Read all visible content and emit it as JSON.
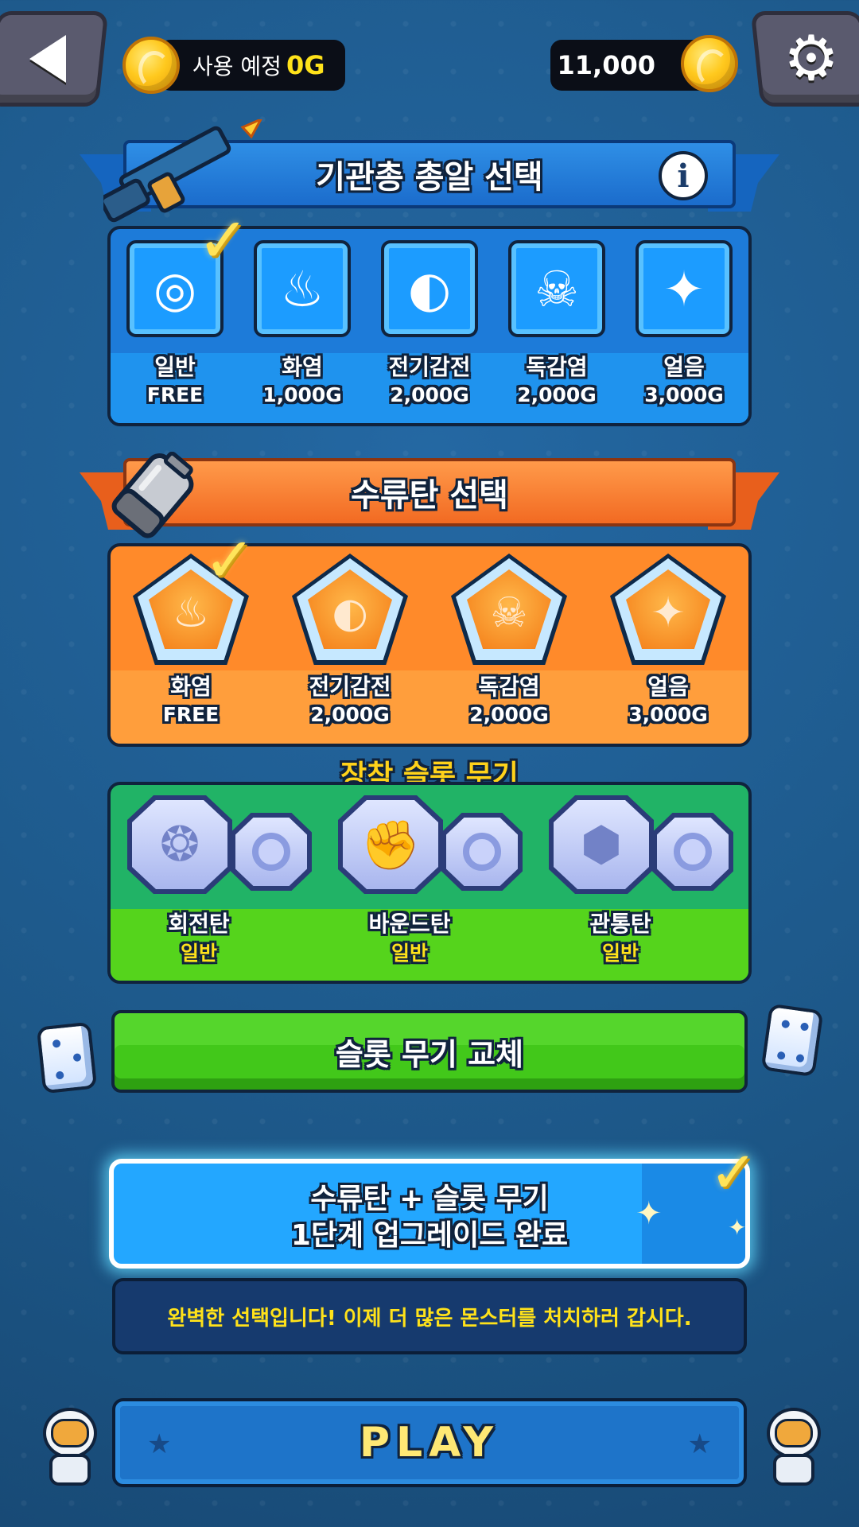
{
  "header": {
    "back_icon": "back-arrow-icon",
    "settings_icon": "gear-icon",
    "planned_label": "사용 예정",
    "planned_value": "0G",
    "balance": "11,000"
  },
  "machine_gun": {
    "title": "기관총 총알 선택",
    "info_label": "i",
    "items": [
      {
        "name": "일반",
        "price": "FREE",
        "icon": "ring-icon",
        "glyph": "◎"
      },
      {
        "name": "화염",
        "price": "1,000G",
        "icon": "flame-icon",
        "glyph": "♨"
      },
      {
        "name": "전기감전",
        "price": "2,000G",
        "icon": "electric-swirl-icon",
        "glyph": "◐"
      },
      {
        "name": "독감염",
        "price": "2,000G",
        "icon": "poison-skull-icon",
        "glyph": "☠"
      },
      {
        "name": "얼음",
        "price": "3,000G",
        "icon": "ice-star-icon",
        "glyph": "✦"
      }
    ],
    "selected_index": 0
  },
  "grenade": {
    "title": "수류탄 선택",
    "items": [
      {
        "name": "화염",
        "price": "FREE",
        "icon": "flame-icon",
        "glyph": "♨"
      },
      {
        "name": "전기감전",
        "price": "2,000G",
        "icon": "electric-swirl-icon",
        "glyph": "◐"
      },
      {
        "name": "독감염",
        "price": "2,000G",
        "icon": "poison-skull-icon",
        "glyph": "☠"
      },
      {
        "name": "얼음",
        "price": "3,000G",
        "icon": "ice-star-icon",
        "glyph": "✦"
      }
    ],
    "selected_index": 0
  },
  "slot_weapons": {
    "title": "장착 슬롯 무기",
    "items": [
      {
        "name": "회전탄",
        "grade": "일반",
        "icon": "spinning-ball-icon",
        "glyph": "❂"
      },
      {
        "name": "바운드탄",
        "grade": "일반",
        "icon": "boxing-glove-icon",
        "glyph": "✊"
      },
      {
        "name": "관통탄",
        "grade": "일반",
        "icon": "hex-nut-icon",
        "glyph": "⬢"
      }
    ]
  },
  "swap_button": {
    "label": "슬롯 무기 교체"
  },
  "upgrade_banner": {
    "line1": "수류탄 + 슬롯 무기",
    "line2": "1단계 업그레이드 완료"
  },
  "message": "완벽한 선택입니다! 이제 더 많은 몬스터를 처치하러 갑시다.",
  "play_button": {
    "label": "PLAY"
  },
  "colors": {
    "background": "#1e5a90",
    "blue_panel": "#1d7bd9",
    "orange_panel": "#ff8a2a",
    "green_panel": "#21b366",
    "accent_yellow": "#ffe21a"
  }
}
